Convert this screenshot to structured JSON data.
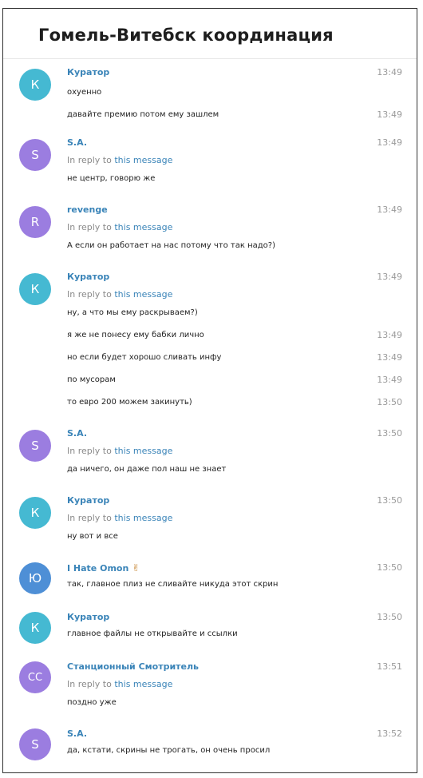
{
  "chat": {
    "title": "Гомель-Витебск координация"
  },
  "colors": {
    "teal": "#45b9d2",
    "purple": "#9b7de0",
    "blue": "#4e8fd6",
    "author": "#3a84b8"
  },
  "reply_prefix": "In reply to",
  "reply_link": "this message",
  "messages": [
    {
      "avatar": "К",
      "author": "Куратор",
      "time": "13:49",
      "reply": false,
      "lines": [
        {
          "text": "охуенно",
          "time": ""
        },
        {
          "text": "давайте премию потом ему зашлем",
          "time": "13:49"
        }
      ]
    },
    {
      "avatar": "S",
      "author": "S.A.",
      "time": "13:49",
      "reply": true,
      "lines": [
        {
          "text": "не центр, говорю же",
          "time": ""
        }
      ]
    },
    {
      "avatar": "R",
      "author": "revenge",
      "time": "13:49",
      "reply": true,
      "lines": [
        {
          "text": "А если он работает на нас потому что так надо?)",
          "time": ""
        }
      ]
    },
    {
      "avatar": "К",
      "author": "Куратор",
      "time": "13:49",
      "reply": true,
      "lines": [
        {
          "text": "ну, а что мы ему раскрываем?)",
          "time": ""
        },
        {
          "text": "я же не понесу ему бабки лично",
          "time": "13:49"
        },
        {
          "text": "но если будет хорошо сливать инфу",
          "time": "13:49"
        },
        {
          "text": "по мусорам",
          "time": "13:49"
        },
        {
          "text": "то евро 200 можем закинуть)",
          "time": "13:50"
        }
      ]
    },
    {
      "avatar": "S",
      "author": "S.A.",
      "time": "13:50",
      "reply": true,
      "lines": [
        {
          "text": "да ничего, он даже пол наш не знает",
          "time": ""
        }
      ]
    },
    {
      "avatar": "К",
      "author": "Куратор",
      "time": "13:50",
      "reply": true,
      "lines": [
        {
          "text": "ну вот и все",
          "time": ""
        }
      ]
    },
    {
      "avatar": "Ю",
      "author": "I Hate Omon",
      "time": "13:50",
      "reply": false,
      "lines": [
        {
          "text": "так, главное плиз не сливайте никуда этот скрин",
          "time": ""
        }
      ]
    },
    {
      "avatar": "К",
      "author": "Куратор",
      "time": "13:50",
      "reply": false,
      "lines": [
        {
          "text": "главное файлы не открывайте и ссылки",
          "time": ""
        }
      ]
    },
    {
      "avatar": "СС",
      "author": "Станционный Смотритель",
      "time": "13:51",
      "reply": true,
      "lines": [
        {
          "text": "поздно уже",
          "time": ""
        }
      ]
    },
    {
      "avatar": "S",
      "author": "S.A.",
      "time": "13:52",
      "reply": false,
      "lines": [
        {
          "text": "да, кстати, скрины не трогать, он очень просил",
          "time": ""
        }
      ]
    }
  ]
}
